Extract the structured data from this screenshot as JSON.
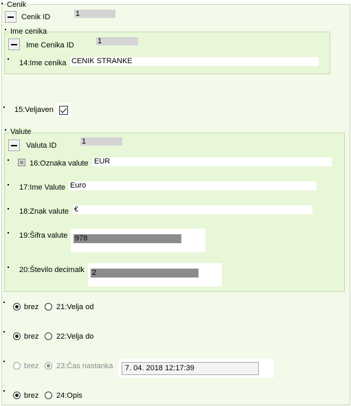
{
  "cenik": {
    "legend": "Cenik",
    "id_label": "Cenik ID",
    "id_value": "1",
    "ime_cenika": {
      "legend": "Ime cenika",
      "id_label": "Ime Cenika ID",
      "id_value": "1",
      "field_label": "14:Ime cenika",
      "field_value": "CENIK STRANKE"
    },
    "veljaven": {
      "label": "15:Veljaven",
      "checked": true
    },
    "valute": {
      "legend": "Valute",
      "id_label": "Valuta ID",
      "id_value": "1",
      "oznaka_label": "16:Oznaka valute",
      "oznaka_value": "EUR",
      "ime_label": "17:Ime Valute",
      "ime_value": "Euro",
      "znak_label": "18:Znak valute",
      "znak_value": "€",
      "sifra_label": "19:Šifra valute",
      "sifra_value": "978",
      "decimalk_label": "20:Število decimalk",
      "decimalk_value": "2"
    },
    "velja_od": {
      "none_label": "brez",
      "label": "21:Velja od",
      "selected": "brez"
    },
    "velja_do": {
      "none_label": "brez",
      "label": "22:Velja do",
      "selected": "brez"
    },
    "cas_nastanka": {
      "none_label": "brez",
      "label": "23:Čas nastanka",
      "selected": "value",
      "value": "7. 04. 2018 12:17:39",
      "disabled": true
    },
    "opis": {
      "none_label": "brez",
      "label": "24:Opis",
      "selected": "brez"
    }
  }
}
